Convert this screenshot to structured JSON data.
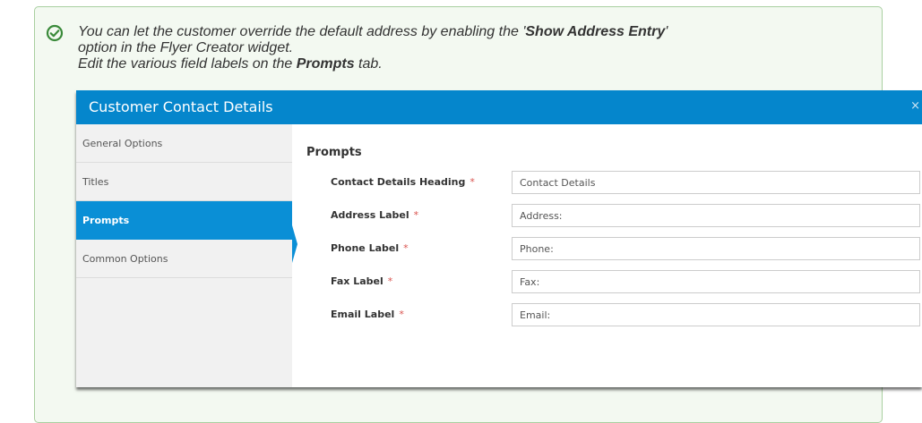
{
  "tip": {
    "icon": "check-circle-icon",
    "line1_prefix": "You can let the customer override the default address by enabling the '",
    "line1_bold": "Show Address Entry",
    "line1_suffix": "'",
    "line2": "option in the Flyer Creator widget.",
    "line3_prefix": "Edit the various field labels on the ",
    "line3_bold": "Prompts",
    "line3_suffix": " tab.",
    "colors": {
      "panel_bg": "#f3f9f1",
      "panel_border": "#a9cfa0",
      "icon": "#3a8a3a"
    }
  },
  "dialog": {
    "title": "Customer Contact Details",
    "close_label": "×",
    "colors": {
      "header": "#0586cc",
      "active_tab": "#0a8fd6",
      "required": "#d9534f"
    },
    "sidebar": {
      "items": [
        {
          "label": "General Options",
          "active": false
        },
        {
          "label": "Titles",
          "active": false
        },
        {
          "label": "Prompts",
          "active": true
        },
        {
          "label": "Common Options",
          "active": false
        }
      ]
    },
    "section_title": "Prompts",
    "required_marker": "*",
    "fields": [
      {
        "label": "Contact Details Heading",
        "value": "Contact Details"
      },
      {
        "label": "Address Label",
        "value": "Address:"
      },
      {
        "label": "Phone Label",
        "value": "Phone:"
      },
      {
        "label": "Fax Label",
        "value": "Fax:"
      },
      {
        "label": "Email Label",
        "value": "Email:"
      }
    ]
  }
}
